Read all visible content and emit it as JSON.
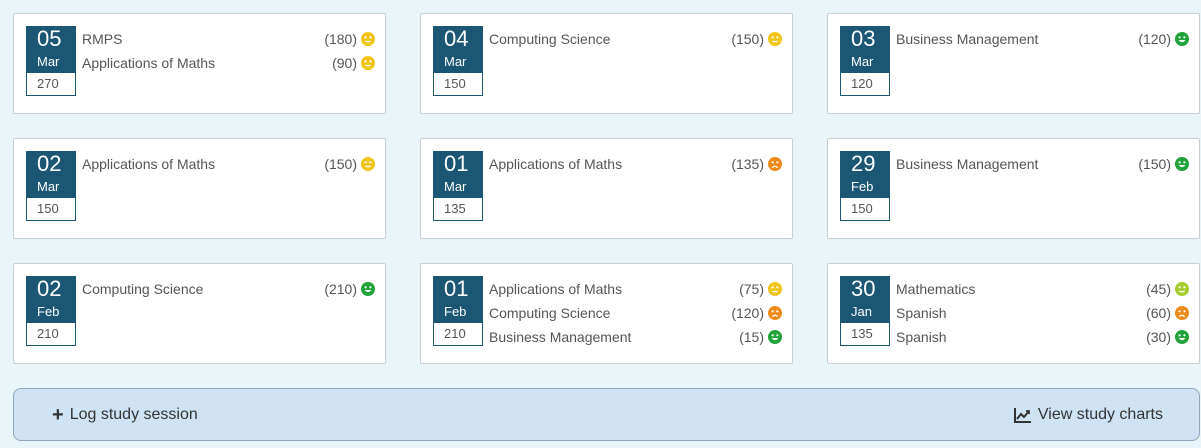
{
  "colors": {
    "date_bg": "#1b5775",
    "happy": "#21a33a",
    "neutral": "#f0c419",
    "slight": "#a6cc2e",
    "sad": "#ef8a1b"
  },
  "cards": [
    {
      "day": "05",
      "month": "Mar",
      "total": "270",
      "entries": [
        {
          "subject": "RMPS",
          "amount": "(180)",
          "mood": "neutral"
        },
        {
          "subject": "Applications of Maths",
          "amount": "(90)",
          "mood": "neutral"
        }
      ]
    },
    {
      "day": "04",
      "month": "Mar",
      "total": "150",
      "entries": [
        {
          "subject": "Computing Science",
          "amount": "(150)",
          "mood": "neutral"
        }
      ]
    },
    {
      "day": "03",
      "month": "Mar",
      "total": "120",
      "entries": [
        {
          "subject": "Business Management",
          "amount": "(120)",
          "mood": "happy"
        }
      ]
    },
    {
      "day": "02",
      "month": "Mar",
      "total": "150",
      "entries": [
        {
          "subject": "Applications of Maths",
          "amount": "(150)",
          "mood": "neutral"
        }
      ]
    },
    {
      "day": "01",
      "month": "Mar",
      "total": "135",
      "entries": [
        {
          "subject": "Applications of Maths",
          "amount": "(135)",
          "mood": "sad"
        }
      ]
    },
    {
      "day": "29",
      "month": "Feb",
      "total": "150",
      "entries": [
        {
          "subject": "Business Management",
          "amount": "(150)",
          "mood": "happy"
        }
      ]
    },
    {
      "day": "02",
      "month": "Feb",
      "total": "210",
      "entries": [
        {
          "subject": "Computing Science",
          "amount": "(210)",
          "mood": "happy"
        }
      ]
    },
    {
      "day": "01",
      "month": "Feb",
      "total": "210",
      "entries": [
        {
          "subject": "Applications of Maths",
          "amount": "(75)",
          "mood": "neutral"
        },
        {
          "subject": "Computing Science",
          "amount": "(120)",
          "mood": "sad"
        },
        {
          "subject": "Business Management",
          "amount": "(15)",
          "mood": "happy"
        }
      ]
    },
    {
      "day": "30",
      "month": "Jan",
      "total": "135",
      "entries": [
        {
          "subject": "Mathematics",
          "amount": "(45)",
          "mood": "slight"
        },
        {
          "subject": "Spanish",
          "amount": "(60)",
          "mood": "sad"
        },
        {
          "subject": "Spanish",
          "amount": "(30)",
          "mood": "happy"
        }
      ]
    }
  ],
  "actions": {
    "log_label": "Log study session",
    "log_icon": "plus-icon",
    "charts_label": "View study charts",
    "charts_icon": "line-chart-icon"
  }
}
